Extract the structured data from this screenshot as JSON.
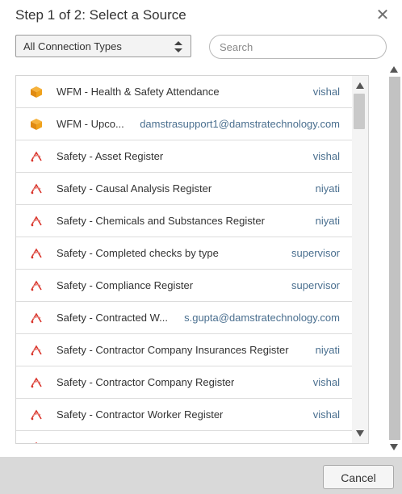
{
  "dialog": {
    "title": "Step 1 of 2: Select a Source",
    "close_label": "✕"
  },
  "filters": {
    "connection_type": "All Connection Types",
    "search_placeholder": "Search"
  },
  "sources": [
    {
      "icon": "box-icon",
      "name": "WFM - Health & Safety Attendance",
      "owner": "vishal"
    },
    {
      "icon": "box-icon",
      "name": "WFM - Upco...",
      "owner": "damstrasupport1@damstratechnology.com"
    },
    {
      "icon": "report-icon",
      "name": "Safety - Asset Register",
      "owner": "vishal"
    },
    {
      "icon": "report-icon",
      "name": "Safety - Causal Analysis Register",
      "owner": "niyati"
    },
    {
      "icon": "report-icon",
      "name": "Safety - Chemicals and Substances Register",
      "owner": "niyati"
    },
    {
      "icon": "report-icon",
      "name": "Safety - Completed checks by type",
      "owner": "supervisor"
    },
    {
      "icon": "report-icon",
      "name": "Safety - Compliance Register",
      "owner": "supervisor"
    },
    {
      "icon": "report-icon",
      "name": "Safety - Contracted W...",
      "owner": "s.gupta@damstratechnology.com"
    },
    {
      "icon": "report-icon",
      "name": "Safety - Contractor Company Insurances Register",
      "owner": "niyati"
    },
    {
      "icon": "report-icon",
      "name": "Safety - Contractor Company Register",
      "owner": "vishal"
    },
    {
      "icon": "report-icon",
      "name": "Safety - Contractor Worker Register",
      "owner": "vishal"
    },
    {
      "icon": "report-icon",
      "name": "",
      "owner": ""
    }
  ],
  "footer": {
    "cancel_label": "Cancel"
  },
  "colors": {
    "owner_text": "#4a6f8f",
    "footer_bg": "#d9d9d9",
    "box_icon": "#f0a21c",
    "report_icon": "#d9342b"
  }
}
